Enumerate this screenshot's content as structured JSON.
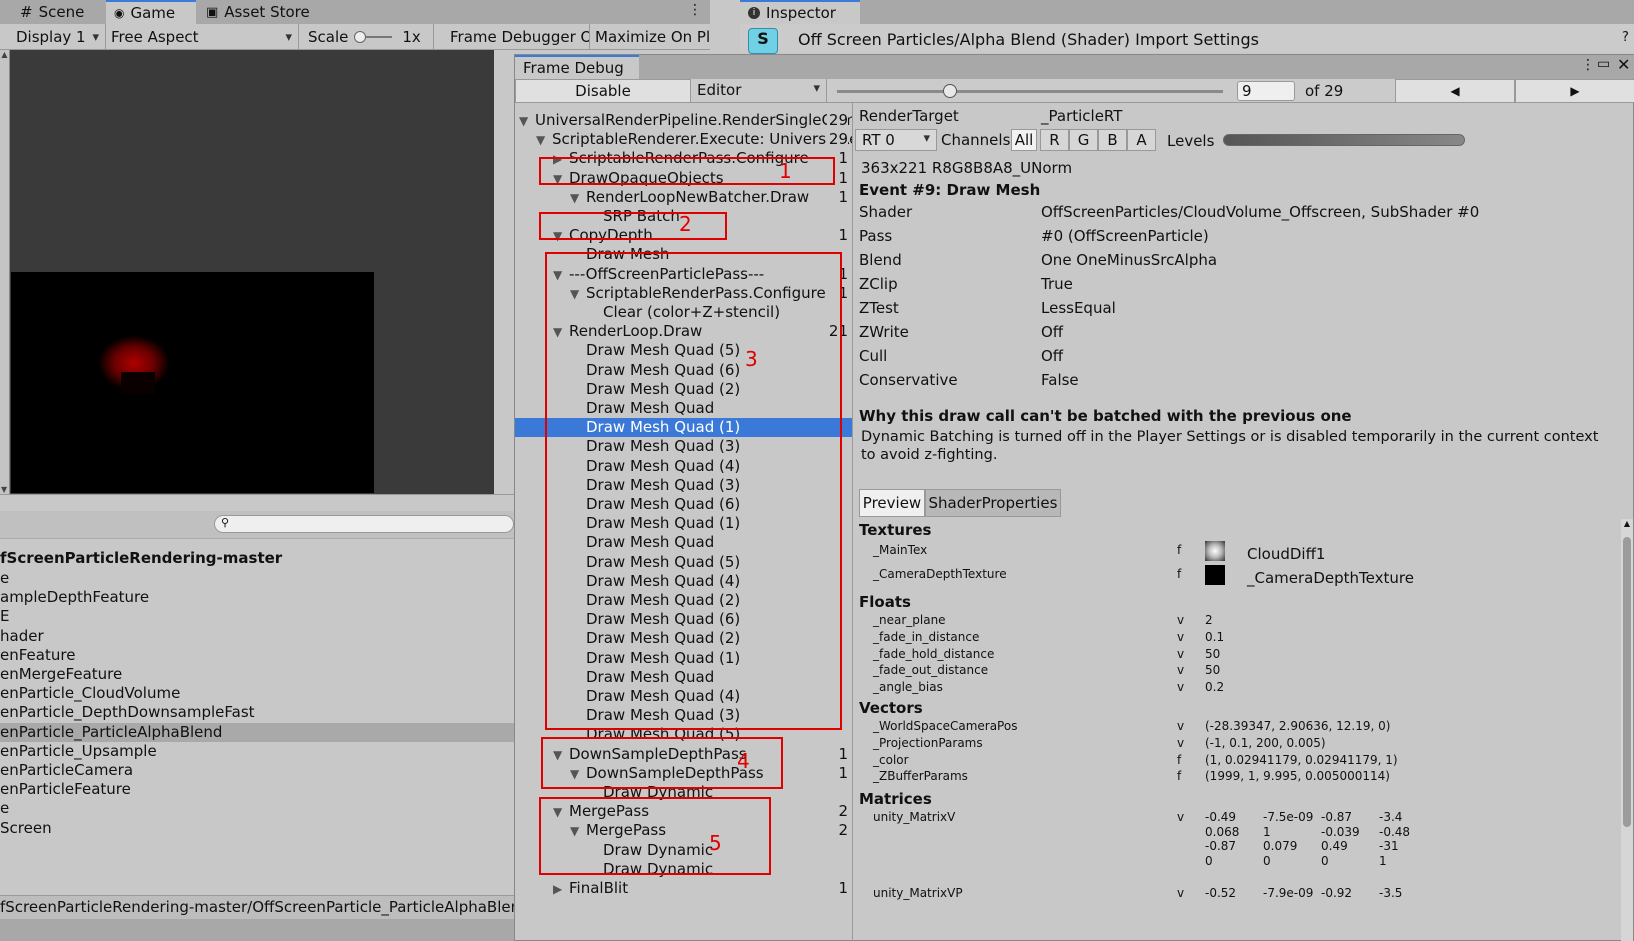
{
  "left_tabs": [
    "Scene",
    "Game",
    "Asset Store"
  ],
  "game_toolbar": {
    "display": "Display 1",
    "aspect": "Free Aspect",
    "scale_label": "Scale",
    "scale_value": "1x",
    "frame_debugger": "Frame Debugger On",
    "maximize": "Maximize On Pla"
  },
  "project_list": {
    "header": "fScreenParticleRendering-master",
    "items": [
      "e",
      "ampleDepthFeature",
      "E",
      "hader",
      "enFeature",
      "enMergeFeature",
      "enParticle_CloudVolume",
      "enParticle_DepthDownsampleFast",
      "enParticle_ParticleAlphaBlend",
      "enParticle_Upsample",
      "enParticleCamera",
      "enParticleFeature",
      "e",
      "Screen"
    ],
    "selected_index": 8,
    "path": "fScreenParticleRendering-master/OffScreenParticle_ParticleAlphaBlend"
  },
  "inspector": {
    "tab": "Inspector",
    "title": "Off Screen Particles/Alpha Blend (Shader) Import Settings"
  },
  "frame_debug": {
    "tab": "Frame Debug",
    "disable": "Disable",
    "editor": "Editor",
    "current": "9",
    "of": "of 29",
    "tree": [
      {
        "label": "UniversalRenderPipeline.RenderSingleCamera",
        "count": "29",
        "indent": 0,
        "tri": "▼"
      },
      {
        "label": "ScriptableRenderer.Execute: UniversalRenderer",
        "count": "29",
        "indent": 1,
        "tri": "▼"
      },
      {
        "label": "ScriptableRenderPass.Configure",
        "count": "1",
        "indent": 2,
        "tri": "▶"
      },
      {
        "label": "DrawOpaqueObjects",
        "count": "1",
        "indent": 2,
        "tri": "▼"
      },
      {
        "label": "RenderLoopNewBatcher.Draw",
        "count": "1",
        "indent": 3,
        "tri": "▼"
      },
      {
        "label": "SRP Batch",
        "count": "",
        "indent": 4,
        "tri": ""
      },
      {
        "label": "CopyDepth",
        "count": "1",
        "indent": 2,
        "tri": "▼"
      },
      {
        "label": "Draw Mesh",
        "count": "",
        "indent": 3,
        "tri": ""
      },
      {
        "label": "---OffScreenParticlePass---",
        "count": "1",
        "indent": 2,
        "tri": "▼"
      },
      {
        "label": "ScriptableRenderPass.Configure",
        "count": "1",
        "indent": 3,
        "tri": "▼"
      },
      {
        "label": "Clear (color+Z+stencil)",
        "count": "",
        "indent": 4,
        "tri": ""
      },
      {
        "label": "RenderLoop.Draw",
        "count": "21",
        "indent": 2,
        "tri": "▼"
      },
      {
        "label": "Draw Mesh Quad (5)",
        "count": "",
        "indent": 3,
        "tri": ""
      },
      {
        "label": "Draw Mesh Quad (6)",
        "count": "",
        "indent": 3,
        "tri": ""
      },
      {
        "label": "Draw Mesh Quad (2)",
        "count": "",
        "indent": 3,
        "tri": ""
      },
      {
        "label": "Draw Mesh Quad",
        "count": "",
        "indent": 3,
        "tri": ""
      },
      {
        "label": "Draw Mesh Quad (1)",
        "count": "",
        "indent": 3,
        "tri": "",
        "selected": true
      },
      {
        "label": "Draw Mesh Quad (3)",
        "count": "",
        "indent": 3,
        "tri": ""
      },
      {
        "label": "Draw Mesh Quad (4)",
        "count": "",
        "indent": 3,
        "tri": ""
      },
      {
        "label": "Draw Mesh Quad (3)",
        "count": "",
        "indent": 3,
        "tri": ""
      },
      {
        "label": "Draw Mesh Quad (6)",
        "count": "",
        "indent": 3,
        "tri": ""
      },
      {
        "label": "Draw Mesh Quad (1)",
        "count": "",
        "indent": 3,
        "tri": ""
      },
      {
        "label": "Draw Mesh Quad",
        "count": "",
        "indent": 3,
        "tri": ""
      },
      {
        "label": "Draw Mesh Quad (5)",
        "count": "",
        "indent": 3,
        "tri": ""
      },
      {
        "label": "Draw Mesh Quad (4)",
        "count": "",
        "indent": 3,
        "tri": ""
      },
      {
        "label": "Draw Mesh Quad (2)",
        "count": "",
        "indent": 3,
        "tri": ""
      },
      {
        "label": "Draw Mesh Quad (6)",
        "count": "",
        "indent": 3,
        "tri": ""
      },
      {
        "label": "Draw Mesh Quad (2)",
        "count": "",
        "indent": 3,
        "tri": ""
      },
      {
        "label": "Draw Mesh Quad (1)",
        "count": "",
        "indent": 3,
        "tri": ""
      },
      {
        "label": "Draw Mesh Quad",
        "count": "",
        "indent": 3,
        "tri": ""
      },
      {
        "label": "Draw Mesh Quad (4)",
        "count": "",
        "indent": 3,
        "tri": ""
      },
      {
        "label": "Draw Mesh Quad (3)",
        "count": "",
        "indent": 3,
        "tri": ""
      },
      {
        "label": "Draw Mesh Quad (5)",
        "count": "",
        "indent": 3,
        "tri": ""
      },
      {
        "label": "DownSampleDepthPass",
        "count": "1",
        "indent": 2,
        "tri": "▼"
      },
      {
        "label": "DownSampleDepthPass",
        "count": "1",
        "indent": 3,
        "tri": "▼"
      },
      {
        "label": "Draw Dynamic",
        "count": "",
        "indent": 4,
        "tri": ""
      },
      {
        "label": "MergePass",
        "count": "2",
        "indent": 2,
        "tri": "▼"
      },
      {
        "label": "MergePass",
        "count": "2",
        "indent": 3,
        "tri": "▼"
      },
      {
        "label": "Draw Dynamic",
        "count": "",
        "indent": 4,
        "tri": ""
      },
      {
        "label": "Draw Dynamic",
        "count": "",
        "indent": 4,
        "tri": ""
      },
      {
        "label": "FinalBlit",
        "count": "1",
        "indent": 2,
        "tri": "▶"
      }
    ],
    "annotations": [
      "1",
      "2",
      "3",
      "4",
      "5"
    ]
  },
  "details": {
    "render_target_label": "RenderTarget",
    "render_target": "_ParticleRT",
    "rt": "RT 0",
    "channels": "Channels",
    "channel_buttons": [
      "All",
      "R",
      "G",
      "B",
      "A"
    ],
    "levels": "Levels",
    "format": "363x221 R8G8B8A8_UNorm",
    "event": "Event #9: Draw Mesh",
    "props": [
      {
        "k": "Shader",
        "v": "OffScreenParticles/CloudVolume_Offscreen, SubShader #0"
      },
      {
        "k": "Pass",
        "v": "#0 (OffScreenParticle)"
      },
      {
        "k": "Blend",
        "v": "One OneMinusSrcAlpha"
      },
      {
        "k": "ZClip",
        "v": "True"
      },
      {
        "k": "ZTest",
        "v": "LessEqual"
      },
      {
        "k": "ZWrite",
        "v": "Off"
      },
      {
        "k": "Cull",
        "v": "Off"
      },
      {
        "k": "Conservative",
        "v": "False"
      }
    ],
    "batch_title": "Why this draw call can't be batched with the previous one",
    "batch_text1": "Dynamic Batching is turned off in the Player Settings or is disabled temporarily in the current context",
    "batch_text2": "to avoid z-fighting.",
    "tabs": [
      "Preview",
      "ShaderProperties"
    ],
    "textures_h": "Textures",
    "textures": [
      {
        "k": "_MainTex",
        "t": "f",
        "v": "CloudDiff1"
      },
      {
        "k": "_CameraDepthTexture",
        "t": "f",
        "v": "_CameraDepthTexture"
      }
    ],
    "floats_h": "Floats",
    "floats": [
      {
        "k": "_near_plane",
        "t": "v",
        "v": "2"
      },
      {
        "k": "_fade_in_distance",
        "t": "v",
        "v": "0.1"
      },
      {
        "k": "_fade_hold_distance",
        "t": "v",
        "v": "50"
      },
      {
        "k": "_fade_out_distance",
        "t": "v",
        "v": "50"
      },
      {
        "k": "_angle_bias",
        "t": "v",
        "v": "0.2"
      }
    ],
    "vectors_h": "Vectors",
    "vectors": [
      {
        "k": "_WorldSpaceCameraPos",
        "t": "v",
        "v": "(-28.39347, 2.90636, 12.19, 0)"
      },
      {
        "k": "_ProjectionParams",
        "t": "v",
        "v": "(-1, 0.1, 200, 0.005)"
      },
      {
        "k": "_color",
        "t": "f",
        "v": "(1, 0.02941179, 0.02941179, 1)"
      },
      {
        "k": "_ZBufferParams",
        "t": "f",
        "v": "(1999, 1, 9.995, 0.005000114)"
      }
    ],
    "matrices_h": "Matrices",
    "matrixV_name": "unity_MatrixV",
    "matrixV_t": "v",
    "matrixV": [
      [
        "-0.49",
        "-7.5e-09",
        "-0.87",
        "-3.4"
      ],
      [
        "0.068",
        "1",
        "-0.039",
        "-0.48"
      ],
      [
        "-0.87",
        "0.079",
        "0.49",
        "-31"
      ],
      [
        "0",
        "0",
        "0",
        "1"
      ]
    ],
    "matrixVP_name": "unity_MatrixVP",
    "matrixVP_t": "v",
    "matrixVP": [
      "-0.52",
      "-7.9e-09",
      "-0.92",
      "-3.5"
    ]
  }
}
